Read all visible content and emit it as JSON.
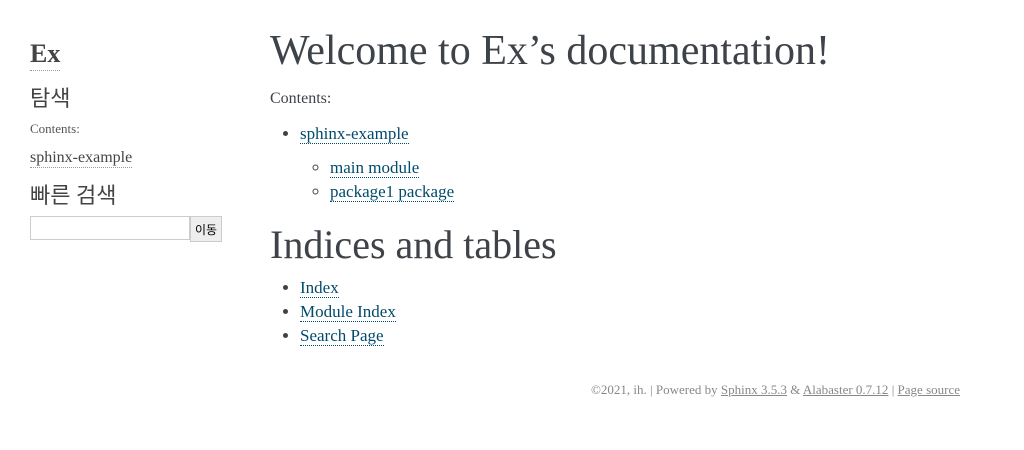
{
  "sidebar": {
    "logo": "Ex",
    "nav_title": "탐색",
    "caption": "Contents:",
    "toc_link": "sphinx-example",
    "search_title": "빠른 검색",
    "search_value": "",
    "search_button": "이동"
  },
  "main": {
    "title": "Welcome to Ex’s documentation!",
    "caption": "Contents:",
    "toc": {
      "top": "sphinx-example",
      "children": [
        "main module",
        "package1 package"
      ]
    },
    "indices_title": "Indices and tables",
    "indices": [
      "Index",
      "Module Index",
      "Search Page"
    ]
  },
  "footer": {
    "copyright": "©2021, ih.",
    "sep1": " | Powered by ",
    "sphinx": "Sphinx 3.5.3",
    "amp": " & ",
    "alabaster": "Alabaster 0.7.12",
    "sep2": " | ",
    "source": "Page source"
  }
}
